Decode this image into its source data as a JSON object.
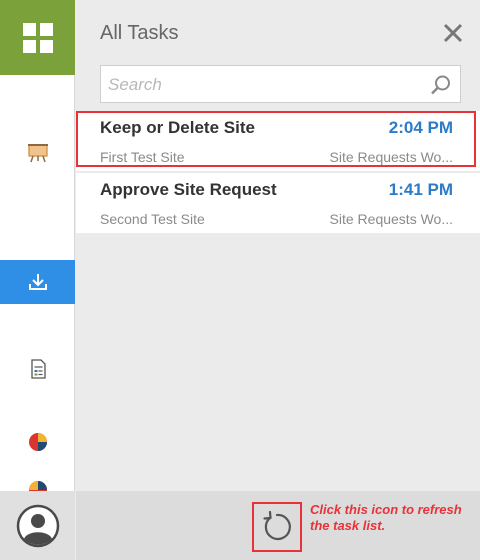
{
  "panel": {
    "title": "All Tasks",
    "search_placeholder": "Search"
  },
  "tasks": [
    {
      "title": "Keep or Delete Site",
      "time": "2:04 PM",
      "site": "First Test Site",
      "list": "Site Requests Wo...",
      "highlighted": true
    },
    {
      "title": "Approve Site Request",
      "time": "1:41 PM",
      "site": "Second Test Site",
      "list": "Site Requests Wo...",
      "highlighted": false
    }
  ],
  "callout": {
    "text": "Click this icon to refresh the task list."
  },
  "rail": {
    "items": [
      {
        "icon": "presentation-icon"
      },
      {
        "icon": "download-icon",
        "active": true
      },
      {
        "icon": "document-icon"
      },
      {
        "icon": "pie-chart-icon"
      },
      {
        "icon": "pie-chart-icon"
      }
    ],
    "footer_icon": "user-avatar-icon"
  },
  "colors": {
    "brand_green": "#7aa13a",
    "active_blue": "#2f8ee5",
    "time_blue": "#2c7bc9",
    "highlight_red": "#e8323a"
  }
}
